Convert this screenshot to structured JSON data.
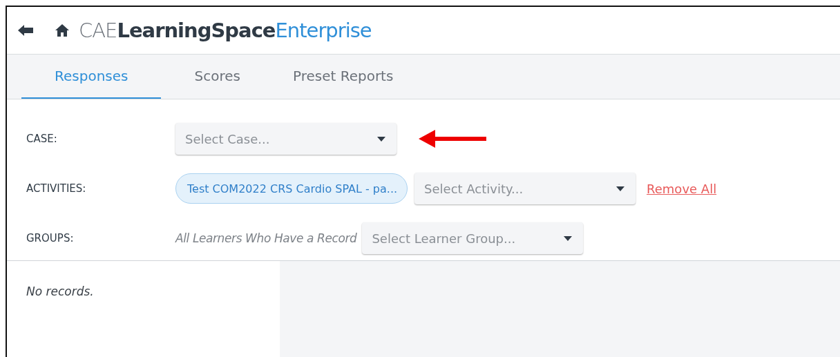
{
  "header": {
    "logo": [
      {
        "text": "CAE",
        "kind": "light"
      },
      {
        "text": "LearningSpace",
        "kind": "bold"
      },
      {
        "text": "Enterprise",
        "kind": "accent"
      }
    ]
  },
  "tabs": [
    {
      "label": "Responses",
      "selected": true
    },
    {
      "label": "Scores",
      "selected": false
    },
    {
      "label": "Preset Reports",
      "selected": false
    }
  ],
  "filters": [
    {
      "label": "CASE:",
      "items": [
        {
          "kind": "select",
          "placeholder": "Select Case...",
          "annotated": true
        }
      ]
    },
    {
      "label": "ACTIVITIES:",
      "items": [
        {
          "kind": "chip",
          "text": "Test COM2022 CRS Cardio SPAL - pa..."
        },
        {
          "kind": "select",
          "placeholder": "Select Activity..."
        },
        {
          "kind": "link",
          "text": "Remove All"
        }
      ]
    },
    {
      "label": "GROUPS:",
      "items": [
        {
          "kind": "note",
          "text": "All Learners Who Have a Record"
        },
        {
          "kind": "select",
          "placeholder": "Select Learner Group..."
        }
      ]
    }
  ],
  "results": {
    "empty_text": "No records."
  }
}
